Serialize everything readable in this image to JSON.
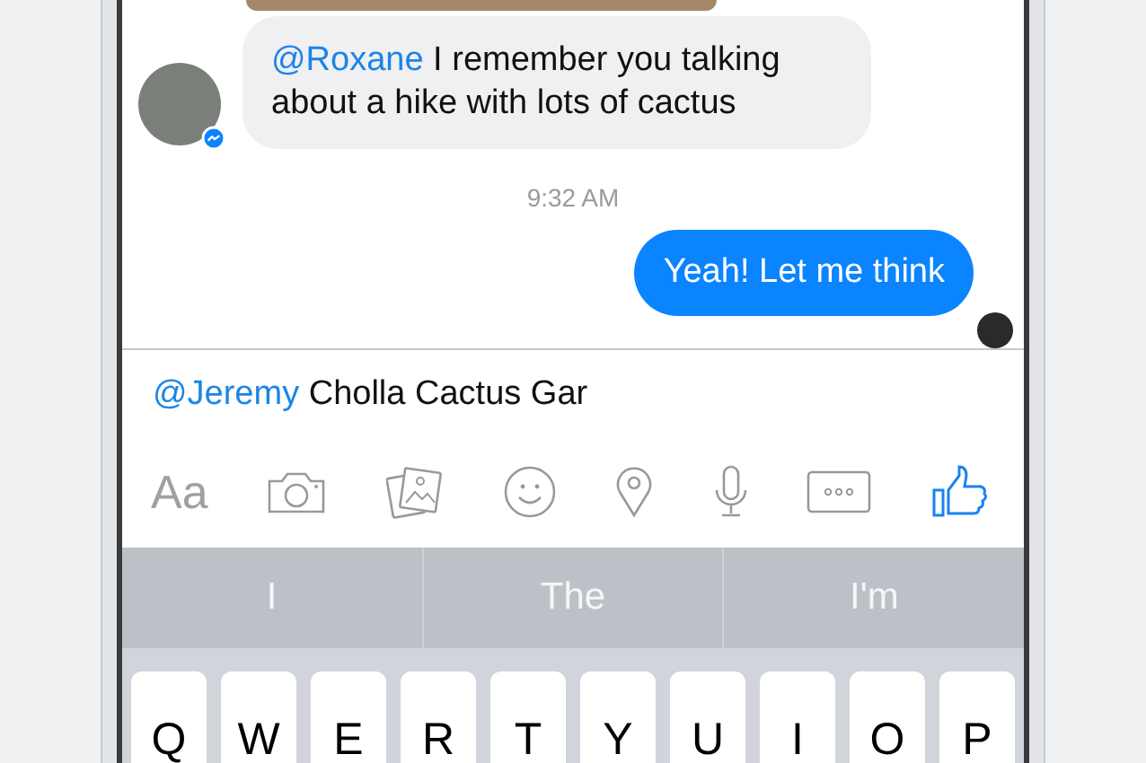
{
  "conversation": {
    "incoming": {
      "mention": "@Roxane",
      "text": "I remember you talking about a hike with lots of cactus"
    },
    "timestamp": "9:32 AM",
    "outgoing": {
      "text": "Yeah! Let me think"
    }
  },
  "composer": {
    "mention": "@Jeremy",
    "value": "Cholla Cactus Gar"
  },
  "toolbar": [
    {
      "kind": "text",
      "label": "Aa"
    },
    {
      "kind": "camera"
    },
    {
      "kind": "gallery"
    },
    {
      "kind": "emoji"
    },
    {
      "kind": "location"
    },
    {
      "kind": "microphone"
    },
    {
      "kind": "more"
    },
    {
      "kind": "like"
    }
  ],
  "suggestions": [
    "I",
    "The",
    "I'm"
  ],
  "keyboard": {
    "keys": [
      "Q",
      "W",
      "E",
      "R",
      "T",
      "Y",
      "U",
      "I",
      "O",
      "P"
    ]
  }
}
